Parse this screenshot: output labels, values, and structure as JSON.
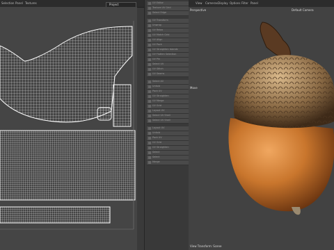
{
  "menu": {
    "m1": "Selection",
    "m2": "Panel",
    "m3": "Textures"
  },
  "uv_toolbar": {
    "project_select": "Project"
  },
  "layer_items": [
    "UV Editor",
    "Texture UV Grid",
    "Select Edge",
    "",
    "UV Transform",
    "Unwrap",
    "UV Relax",
    "UV Match Grid",
    "UV Align",
    "UV Pack",
    "UV Straighten Islands",
    "UV Flatten Selection",
    "UV Pin",
    "Select UV",
    "UV Stitch",
    "UV Seams",
    "",
    "Select All",
    "Unfold",
    "Pack UV",
    "UV Straighten",
    "UV Merge",
    "UV Grid",
    "Layout UV",
    "Select UV Shell",
    "Select UV Shell",
    "",
    "Layout UV",
    "Unfold",
    "Pack UV",
    "UV Grid",
    "UV Straighten",
    "Select",
    "Select",
    "Merge"
  ],
  "viewport_menu": {
    "view": "View",
    "cameras": "Cameras",
    "display": "Display",
    "options": "Options",
    "filter": "Filter",
    "panel": "Panel"
  },
  "viewport": {
    "perspective": "Perspective",
    "camera": "Default Camera",
    "move": "Move",
    "status": "View Transform: Scene"
  },
  "colors": {
    "shell": "#ededed",
    "acorn_body": "#c9762d",
    "cap": "#8a6a45"
  }
}
